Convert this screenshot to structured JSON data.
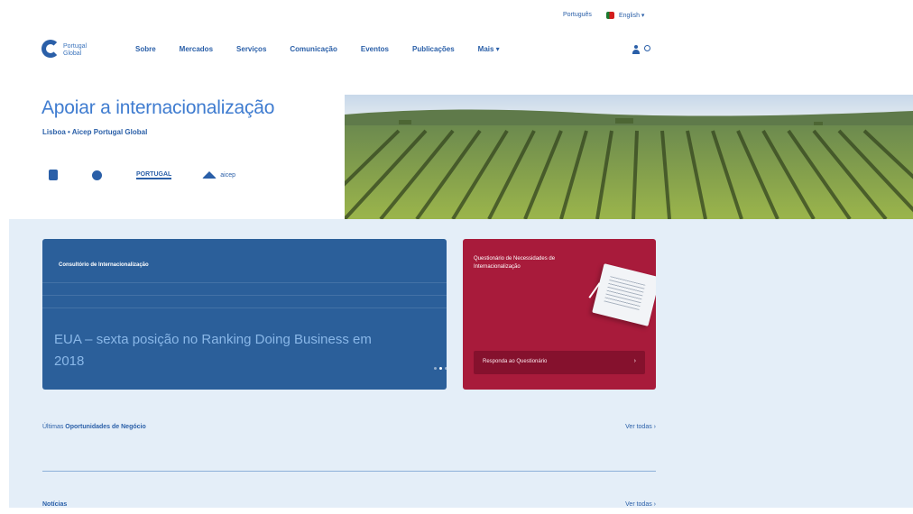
{
  "header": {
    "lang_link": "Português",
    "lang_select": "English ▾",
    "logo_text": "Portugal Global",
    "nav": [
      "Sobre",
      "Mercados",
      "Serviços",
      "Comunicação",
      "Eventos",
      "Publicações",
      "Mais ▾"
    ]
  },
  "hero": {
    "title": "Apoiar a internacionalização",
    "subtitle": "Lisboa  •  Aicep Portugal Global",
    "partners": [
      {
        "label": ""
      },
      {
        "label": ""
      },
      {
        "label": "PORTUGAL"
      },
      {
        "label": "aicep"
      }
    ]
  },
  "news": {
    "kicker": "Consultório de Internacionalização",
    "headline": "EUA – sexta posição no Ranking Doing Business em 2018",
    "active_slide": 2,
    "slide_count": 3
  },
  "promo": {
    "title": "Questionário de Necessidades de Internacionalização",
    "cta": "Responda ao Questionário",
    "cta_chevron": "›"
  },
  "sections": [
    {
      "prefix": "Últimas ",
      "title": "Oportunidades de Negócio",
      "see_all": "Ver todas ›"
    },
    {
      "prefix": "",
      "title": "Notícias",
      "see_all": "Ver todas ›"
    }
  ],
  "colors": {
    "brand_blue": "#2a5fa8",
    "news_card": "#2b5f9a",
    "promo_card": "#a81b3b",
    "main_bg": "#e4eef8"
  }
}
